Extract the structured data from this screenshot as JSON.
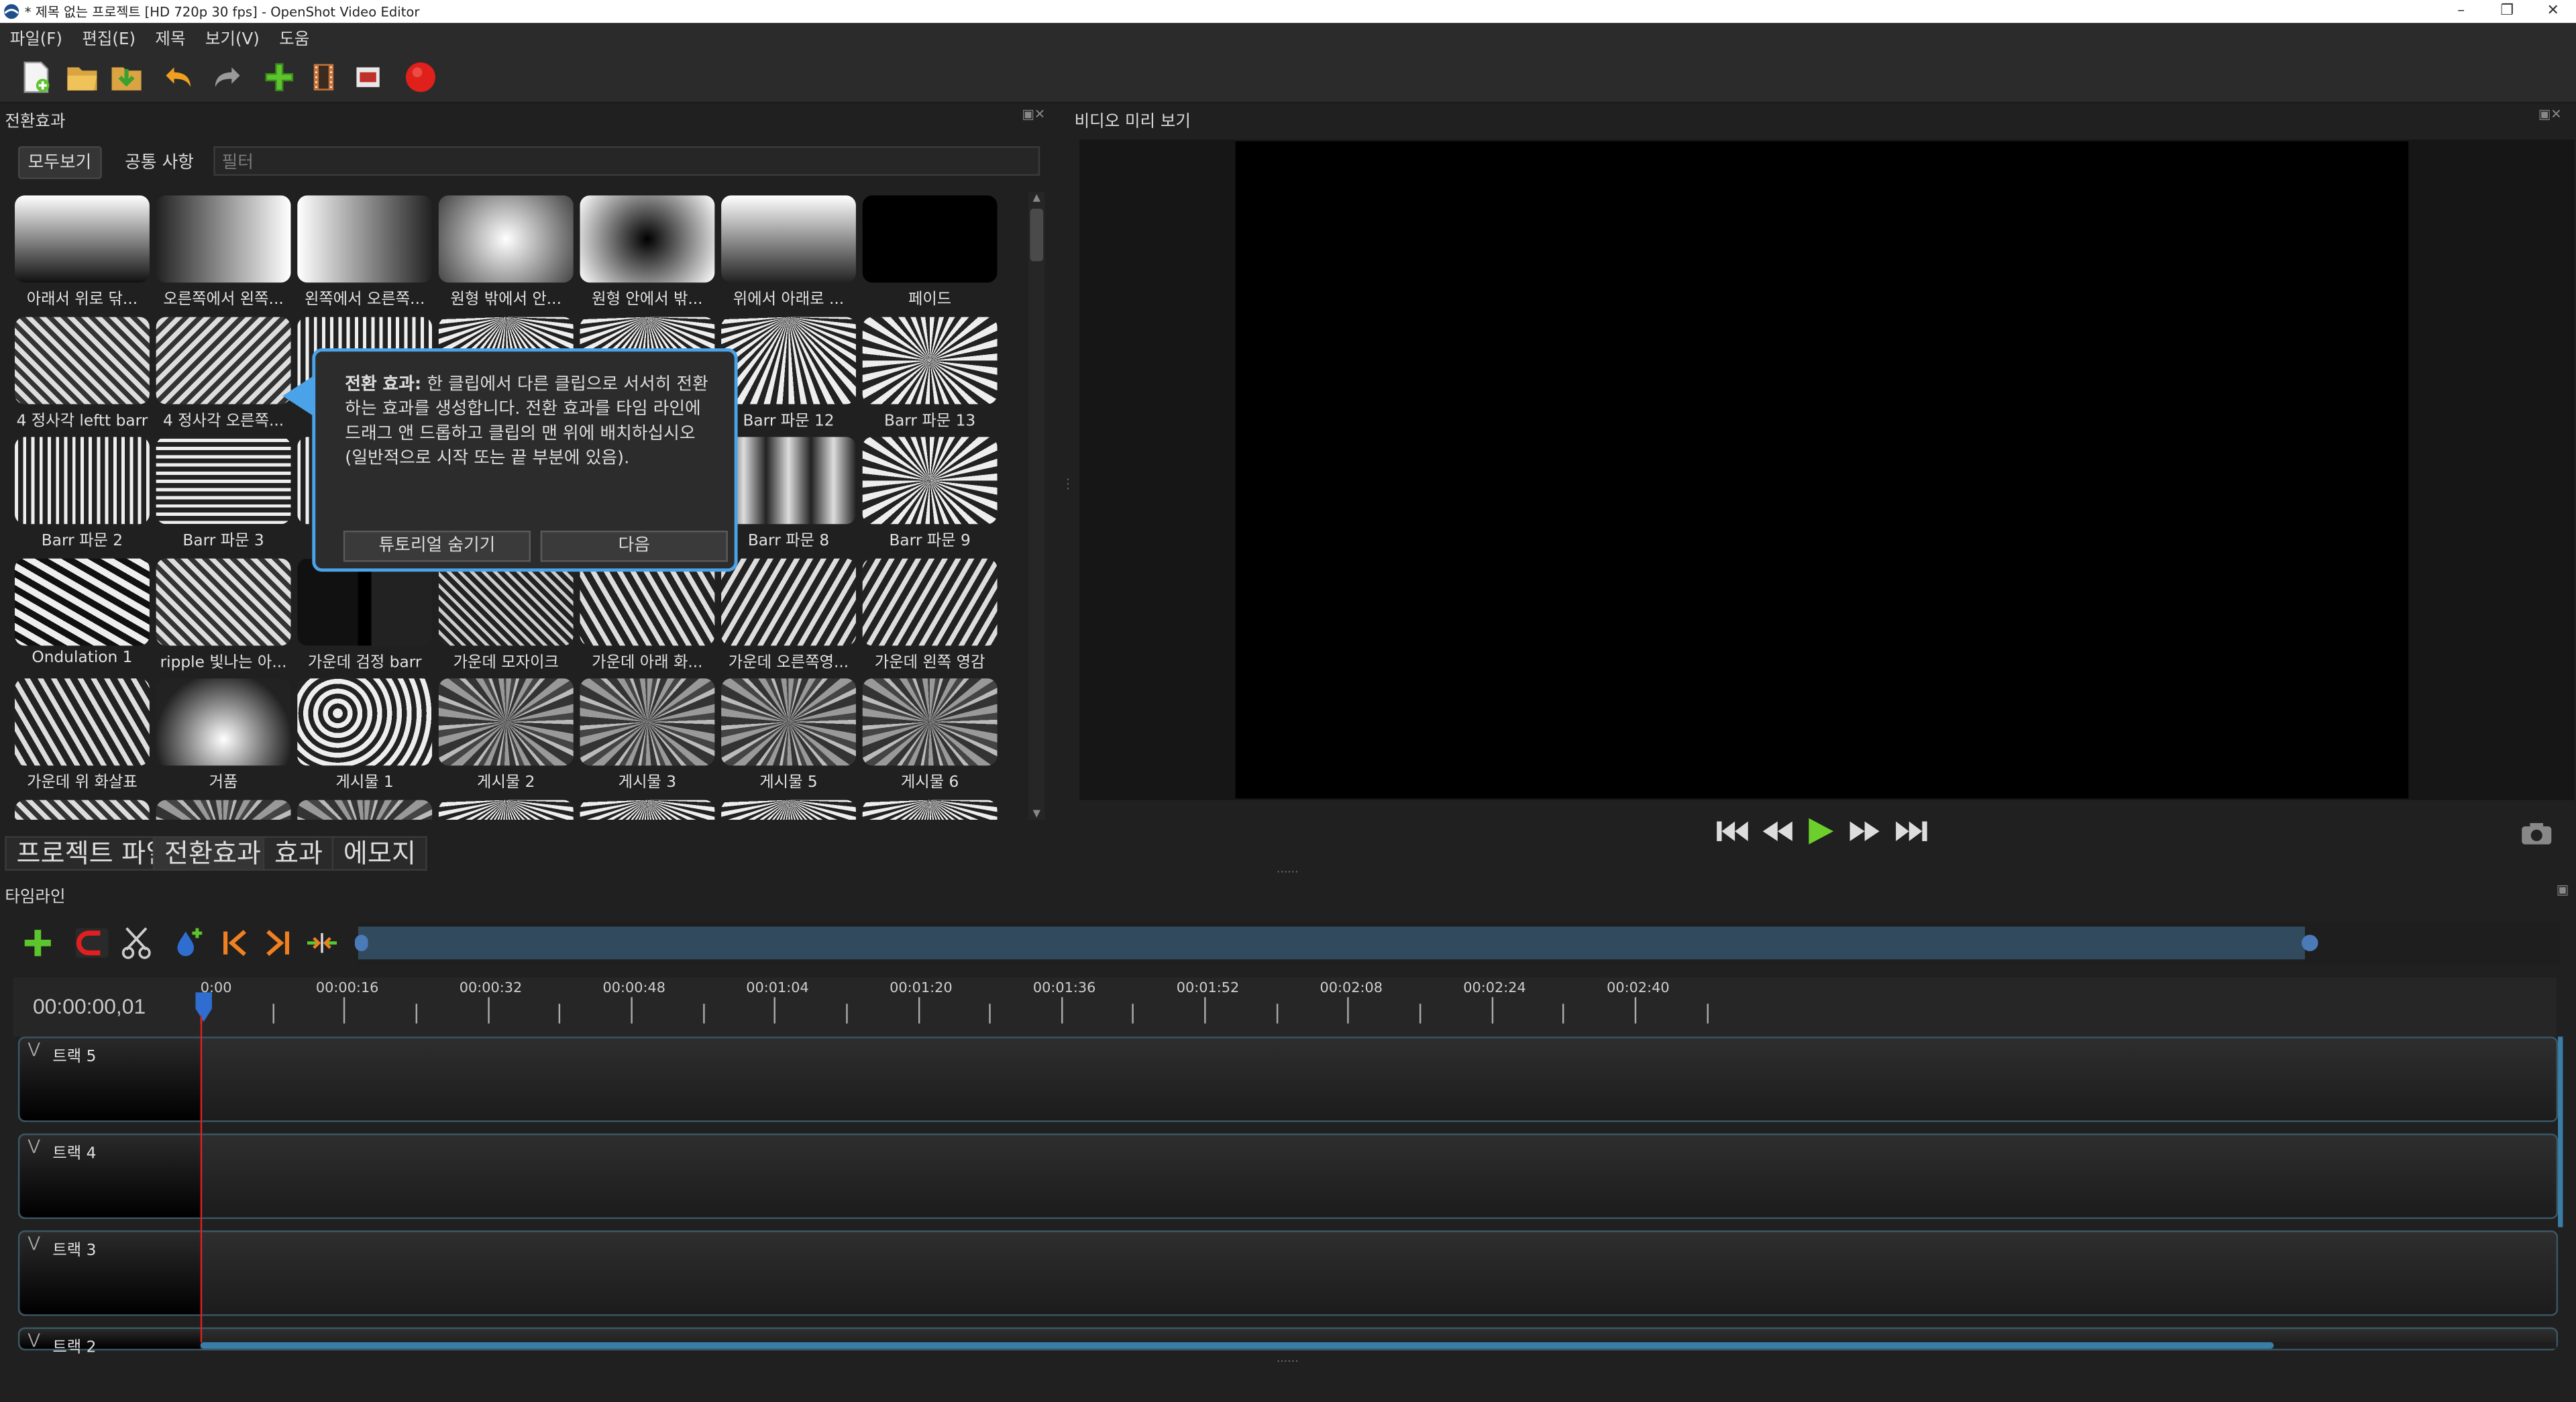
{
  "window": {
    "title": "* 제목 없는 프로젝트 [HD 720p 30 fps] - OpenShot Video Editor",
    "controls": [
      "–",
      "❐",
      "✕"
    ]
  },
  "menu": [
    "파일(F)",
    "편집(E)",
    "제목",
    "보기(V)",
    "도움"
  ],
  "toolbar_icons": [
    "new-file-icon",
    "open-folder-icon",
    "save-icon",
    "undo-icon",
    "redo-icon",
    "import-files-icon",
    "choose-profile-icon",
    "fullscreen-icon",
    "export-video-icon"
  ],
  "transitions_panel": {
    "title": "전환효과",
    "filter_buttons": [
      "모두보기",
      "공통 사항"
    ],
    "filter_placeholder": "필터",
    "items": [
      {
        "label": "아래서 위로 닦...",
        "style": "grad-up"
      },
      {
        "label": "오른쪽에서 왼쪽...",
        "style": "grad-left"
      },
      {
        "label": "왼쪽에서 오른쪽...",
        "style": "grad-right"
      },
      {
        "label": "원형 밖에서 안...",
        "style": "radial-in"
      },
      {
        "label": "원형 안에서 밖...",
        "style": "radial-out"
      },
      {
        "label": "위에서 아래로 ...",
        "style": "grad-down"
      },
      {
        "label": "페이드",
        "style": "fade"
      },
      {
        "label": "4 정사각 leftt barr",
        "style": "diag"
      },
      {
        "label": "4 정사각 오른쪽...",
        "style": "diag2"
      },
      {
        "label": "",
        "style": "vstripe"
      },
      {
        "label": "",
        "style": "rays"
      },
      {
        "label": "",
        "style": "rays"
      },
      {
        "label": "Barr 파문 12",
        "style": "rays"
      },
      {
        "label": "Barr 파문 13",
        "style": "burst"
      },
      {
        "label": "Barr 파문 2",
        "style": "vstripe"
      },
      {
        "label": "Barr 파문 3",
        "style": "hstripe"
      },
      {
        "label": "",
        "style": "vstripe"
      },
      {
        "label": "",
        "style": "vstripe"
      },
      {
        "label": "",
        "style": "vstripe"
      },
      {
        "label": "Barr 파문 8",
        "style": "bars"
      },
      {
        "label": "Barr 파문 9",
        "style": "burst"
      },
      {
        "label": "Ondulation 1",
        "style": "zigzag"
      },
      {
        "label": "ripple 빛나는 아...",
        "style": "diag"
      },
      {
        "label": "가운데 검정 barr",
        "style": "blackbars"
      },
      {
        "label": "가운데 모자이크",
        "style": "diamond"
      },
      {
        "label": "가운데 아래 화...",
        "style": "chevron-down"
      },
      {
        "label": "가운데 오른쪽영...",
        "style": "chevron-right"
      },
      {
        "label": "가운데 왼쪽 영감",
        "style": "chevron-left"
      },
      {
        "label": "가운데 위 화살표",
        "style": "chevron-up"
      },
      {
        "label": "거품",
        "style": "bubble"
      },
      {
        "label": "게시물 1",
        "style": "wave"
      },
      {
        "label": "게시물 2",
        "style": "noise"
      },
      {
        "label": "게시물 3",
        "style": "noise"
      },
      {
        "label": "게시물 5",
        "style": "noise"
      },
      {
        "label": "게시물 6",
        "style": "noise"
      },
      {
        "label": "",
        "style": "diag"
      },
      {
        "label": "",
        "style": "noise"
      },
      {
        "label": "",
        "style": "noise"
      },
      {
        "label": "",
        "style": "rays"
      },
      {
        "label": "",
        "style": "rays"
      },
      {
        "label": "",
        "style": "rays"
      },
      {
        "label": "",
        "style": "rays"
      }
    ]
  },
  "tutorial": {
    "bold": "전환 효과:",
    "text": " 한 클립에서 다른 클립으로 서서히 전환하는 효과를 생성합니다. 전환 효과를 타임 라인에 드래그 앤 드롭하고 클립의 맨 위에 배치하십시오 (일반적으로 시작 또는 끝 부분에 있음).",
    "hide_label": "튜토리얼 숨기기",
    "next_label": "다음"
  },
  "bottom_tabs": [
    "프로젝트 파일",
    "전환효과",
    "효과",
    "에모지"
  ],
  "preview_panel": {
    "title": "비디오 미리 보기",
    "controls": [
      "jump-start-icon",
      "rewind-icon",
      "play-icon",
      "fast-forward-icon",
      "jump-end-icon"
    ]
  },
  "timeline": {
    "title": "타임라인",
    "tools": [
      "add-track-icon",
      "snap-magnet-icon",
      "razor-icon",
      "add-marker-icon",
      "previous-marker-icon",
      "next-marker-icon",
      "center-playhead-icon"
    ],
    "time_display": "00:00:00,01",
    "ruler_labels": [
      "0:00",
      "00:00:16",
      "00:00:32",
      "00:00:48",
      "00:01:04",
      "00:01:20",
      "00:01:36",
      "00:01:52",
      "00:02:08",
      "00:02:24",
      "00:02:40"
    ],
    "tracks": [
      "트랙 5",
      "트랙 4",
      "트랙 3",
      "트랙 2"
    ]
  },
  "colors": {
    "accent_blue": "#4aa3e8",
    "playhead_red": "#e02020",
    "play_green": "#5cc42c"
  }
}
